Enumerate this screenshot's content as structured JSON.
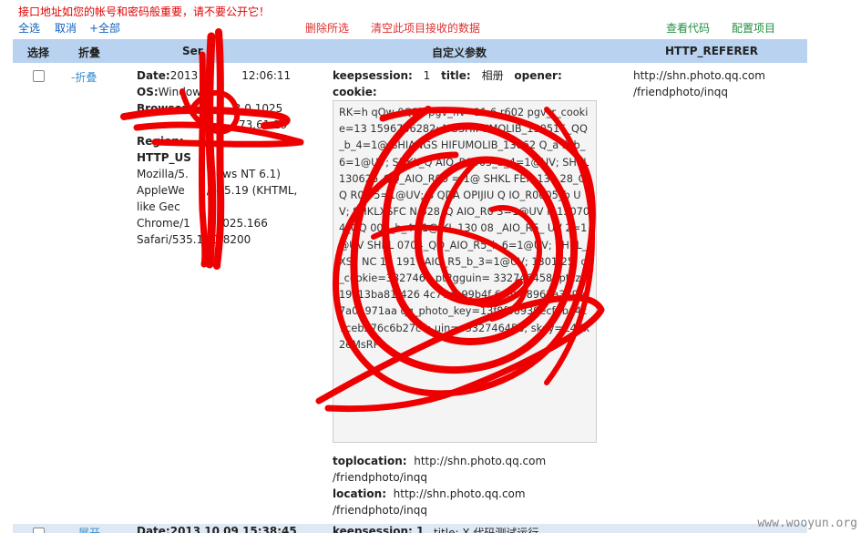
{
  "warning": "接口地址如您的帐号和密码般重要，请不要公开它！",
  "toolbar": {
    "select_all": "全选",
    "cancel": "取消",
    "all_plus": "+全部",
    "delete_selected": "删除所选",
    "clear_data": "清空此项目接收的数据",
    "view_code": "查看代码",
    "config_project": "配置项目"
  },
  "table": {
    "headers": [
      "选择",
      "折叠",
      "Ser",
      "自定义参数",
      "HTTP_REFERER"
    ],
    "row1": {
      "fold_label": "-折叠",
      "server": [
        {
          "key": "Date:",
          "val": "2013"
        },
        {
          "key": "",
          "val": "12:06:11"
        },
        {
          "key": "OS:",
          "val": "Window"
        },
        {
          "key": "Browser:",
          "val": "C"
        },
        {
          "key": "",
          "val": "3.0.1025"
        },
        {
          "key": "",
          "val": "73.61.19"
        },
        {
          "key": "Region:",
          "val": ""
        },
        {
          "key": "HTTP_US",
          "val": ""
        },
        {
          "key": "",
          "val": "AGENT:"
        }
      ],
      "user_agent_lines": [
        "Mozilla/5.",
        "ows NT 6.1)",
        "AppleWe",
        "/535.19 (KHTML,",
        "like Gec",
        "Chrome/1",
        ".1025.166",
        "Safari/535.1",
        "Q",
        "/8200"
      ],
      "custom_line1": {
        "k1": "keepsession:",
        "v1": "1",
        "k2": "title:",
        "v2": "相册",
        "k3": "opener:"
      },
      "cookie_label": "cookie:",
      "cookie_text": "RK=h qQw 0Q2l; pgv_flv=11.6 r602 pgv_r_cookie=13 1596756282; NGSHIFUMOLIB_130516_QQ_b_4=1@ SHIANGS HIFUMOLIB_13062 Q_a 5_b_6=1@UV; SHKL_Q AIO_R0005_b_4=1@UV; SHKL 130626_QQ_AIO_R00 = 1@ SHKL FEN 130 28_QQ R00 5=1@UV; S QDA OPIJIU Q IO_R0005_b UV; SHKLXSFC N 628_Q AIO_R0 3=1@UV K 130704_QQ 005_b_4=1@ KL 130 08 _AIO_R5_ UV 2=1@UV SHKL 0704_QQ_AIO_R5_b 6=1@UV; SHKL_XSF NC 13 191 _AIO_R5_b_3=1@UV; 1301 25; o_cookie=332746 ; pt2gguin= 332746458; ptcz=19c13ba81f426 4c77de99b4f 6cdb98963a379e 7a01971aa qq_photo_key=13f8f36939ecf4ba4c7ceb276c6b27c4; uin=o332746458; skey=Z4Zx2eMsRP",
      "toplocation_key": "toplocation:",
      "toplocation_val": "http://shn.photo.qq.com",
      "toplocation_val2": "/friendphoto/inqq",
      "location_key": "location:",
      "location_val": "http://shn.photo.qq.com",
      "location_val2": "/friendphoto/inqq",
      "referer_line1": "http://shn.photo.qq.com",
      "referer_line2": "/friendphoto/inqq"
    },
    "row2": {
      "fold_label": "展开",
      "date": "Date:2013 10 09 15:38:45",
      "keepsession": "keepsession: 1",
      "title": "title: X 代码测试运行"
    }
  },
  "watermark": "www.wooyun.org",
  "colors": {
    "header_bg": "#b8d2ef",
    "warning": "#e00000",
    "scribble": "#ee0000"
  }
}
